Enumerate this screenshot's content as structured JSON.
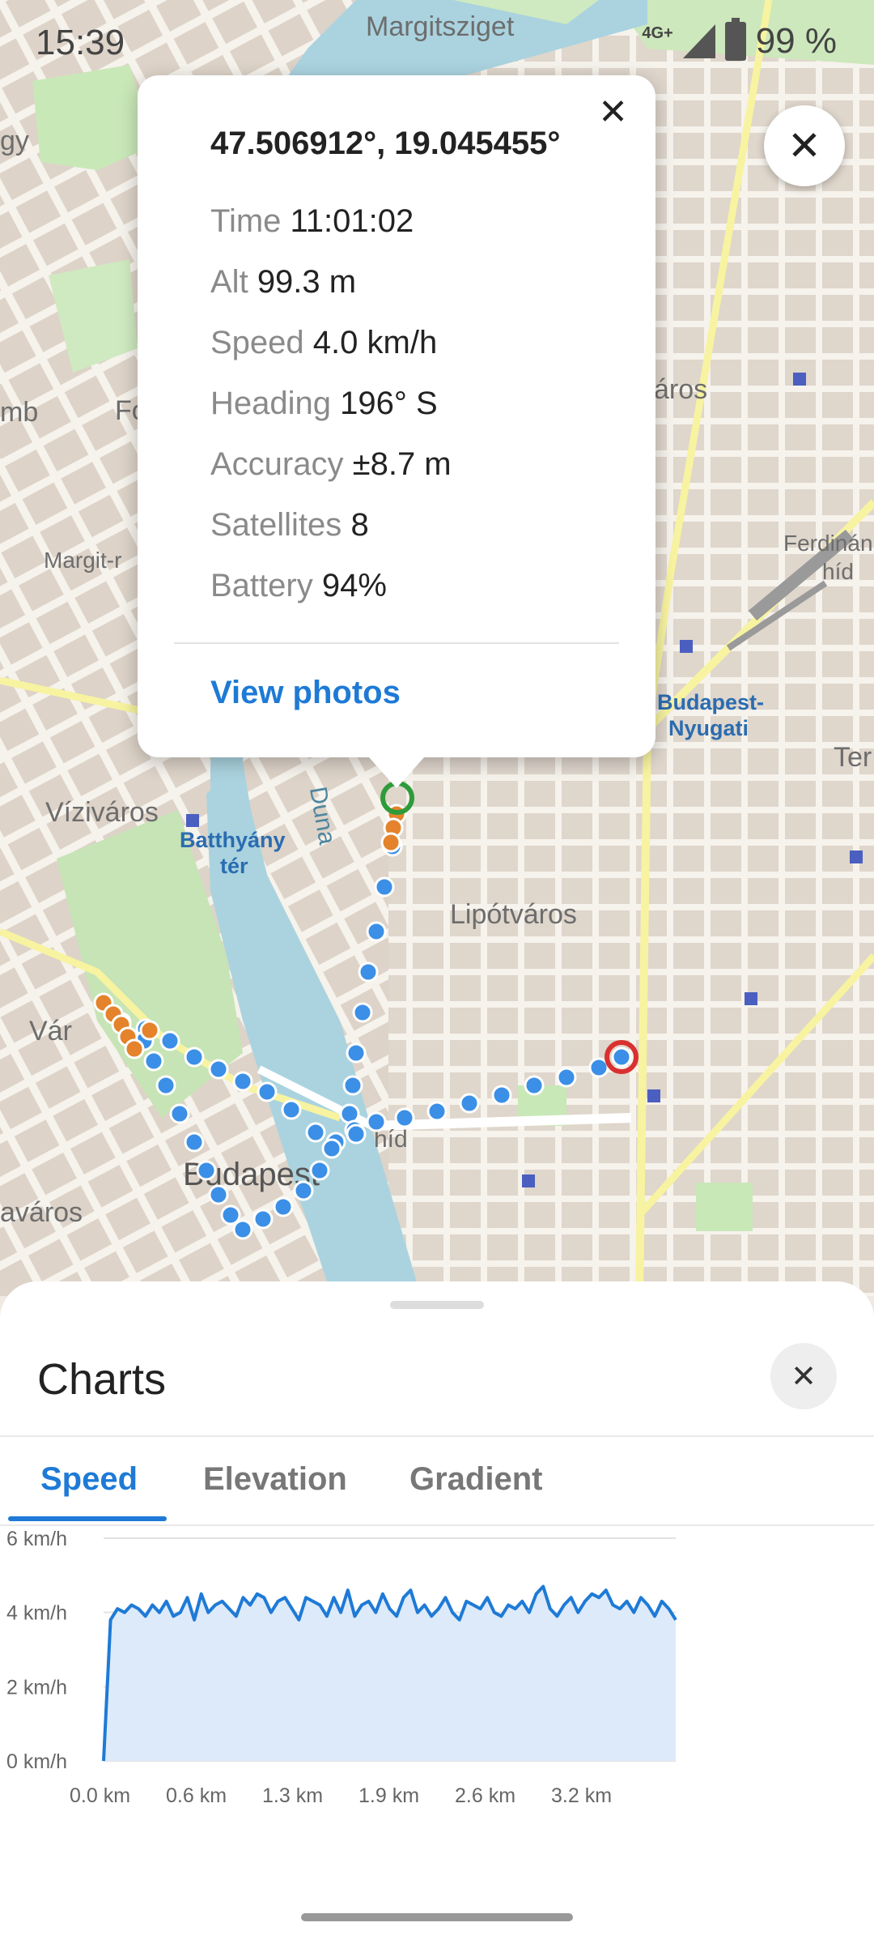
{
  "status_bar": {
    "time": "15:39",
    "network": "4G+",
    "battery": "99 %"
  },
  "map": {
    "labels": {
      "margitsziget": "Margitsziget",
      "gy": "gy",
      "fo": "Fo",
      "mb": "mb",
      "margit": "Margit-r",
      "aros": "áros",
      "ferdinand": "Ferdinán",
      "hid": "híd",
      "nyugati1": "Budapest-",
      "nyugati2": "Nyugati",
      "ter_right": "Ter",
      "viziv": "Víziváros",
      "batthyany1": "Batthyány",
      "batthyany2": "tér",
      "duna": "Duna",
      "lipotvaros": "Lipótváros",
      "var": "Vár",
      "budapest": "Budapest",
      "varos": "aváros",
      "hid_bottom": "híd"
    }
  },
  "popup": {
    "coords": "47.506912°, 19.045455°",
    "rows": [
      {
        "k": "Time",
        "v": "11:01:02"
      },
      {
        "k": "Alt",
        "v": "99.3 m"
      },
      {
        "k": "Speed",
        "v": "4.0 km/h"
      },
      {
        "k": "Heading",
        "v": "196° S"
      },
      {
        "k": "Accuracy",
        "v": "±8.7 m"
      },
      {
        "k": "Satellites",
        "v": "8"
      },
      {
        "k": "Battery",
        "v": "94%"
      }
    ],
    "view_photos": "View photos",
    "close_icon": "close-icon"
  },
  "sheet": {
    "title": "Charts",
    "tabs": [
      "Speed",
      "Elevation",
      "Gradient"
    ],
    "active_tab": 0
  },
  "colors": {
    "accent": "#1e7ad6",
    "track_blue": "#3b8fe6",
    "track_orange": "#e4832b",
    "start_green": "#2e9b3a",
    "end_red": "#d93030"
  },
  "chart_data": {
    "type": "area",
    "title": "",
    "xlabel": "",
    "ylabel": "",
    "y_unit": "km/h",
    "x_unit": "km",
    "yticks": [
      "0 km/h",
      "2 km/h",
      "4 km/h",
      "6 km/h"
    ],
    "xticks": [
      "0.0 km",
      "0.6 km",
      "1.3 km",
      "1.9 km",
      "2.6 km",
      "3.2 km"
    ],
    "xlim": [
      0,
      3.6
    ],
    "ylim": [
      0,
      6
    ],
    "grid": true,
    "series": [
      {
        "values": [
          0.0,
          3.8,
          4.1,
          4.0,
          4.2,
          4.1,
          3.9,
          4.2,
          4.0,
          4.3,
          3.9,
          4.0,
          4.4,
          3.8,
          4.5,
          4.0,
          4.2,
          4.3,
          4.1,
          3.9,
          4.4,
          4.2,
          4.5,
          4.4,
          4.0,
          4.3,
          4.4,
          4.1,
          3.8,
          4.4,
          4.3,
          4.2,
          3.9,
          4.4,
          4.0,
          4.6,
          3.9,
          4.2,
          4.3,
          4.0,
          4.5,
          4.1,
          3.9,
          4.4,
          4.6,
          4.0,
          4.2,
          3.9,
          4.1,
          4.4,
          4.0,
          3.8,
          4.3,
          4.2,
          4.1,
          4.4,
          4.0,
          3.9,
          4.2,
          4.1,
          4.3,
          4.0,
          4.5,
          4.7,
          4.1,
          3.9,
          4.2,
          4.4,
          4.0,
          4.3,
          4.5,
          4.4,
          4.6,
          4.2,
          4.1,
          4.3,
          4.0,
          4.4,
          4.2,
          3.9,
          4.3,
          4.1,
          3.8
        ]
      }
    ]
  }
}
